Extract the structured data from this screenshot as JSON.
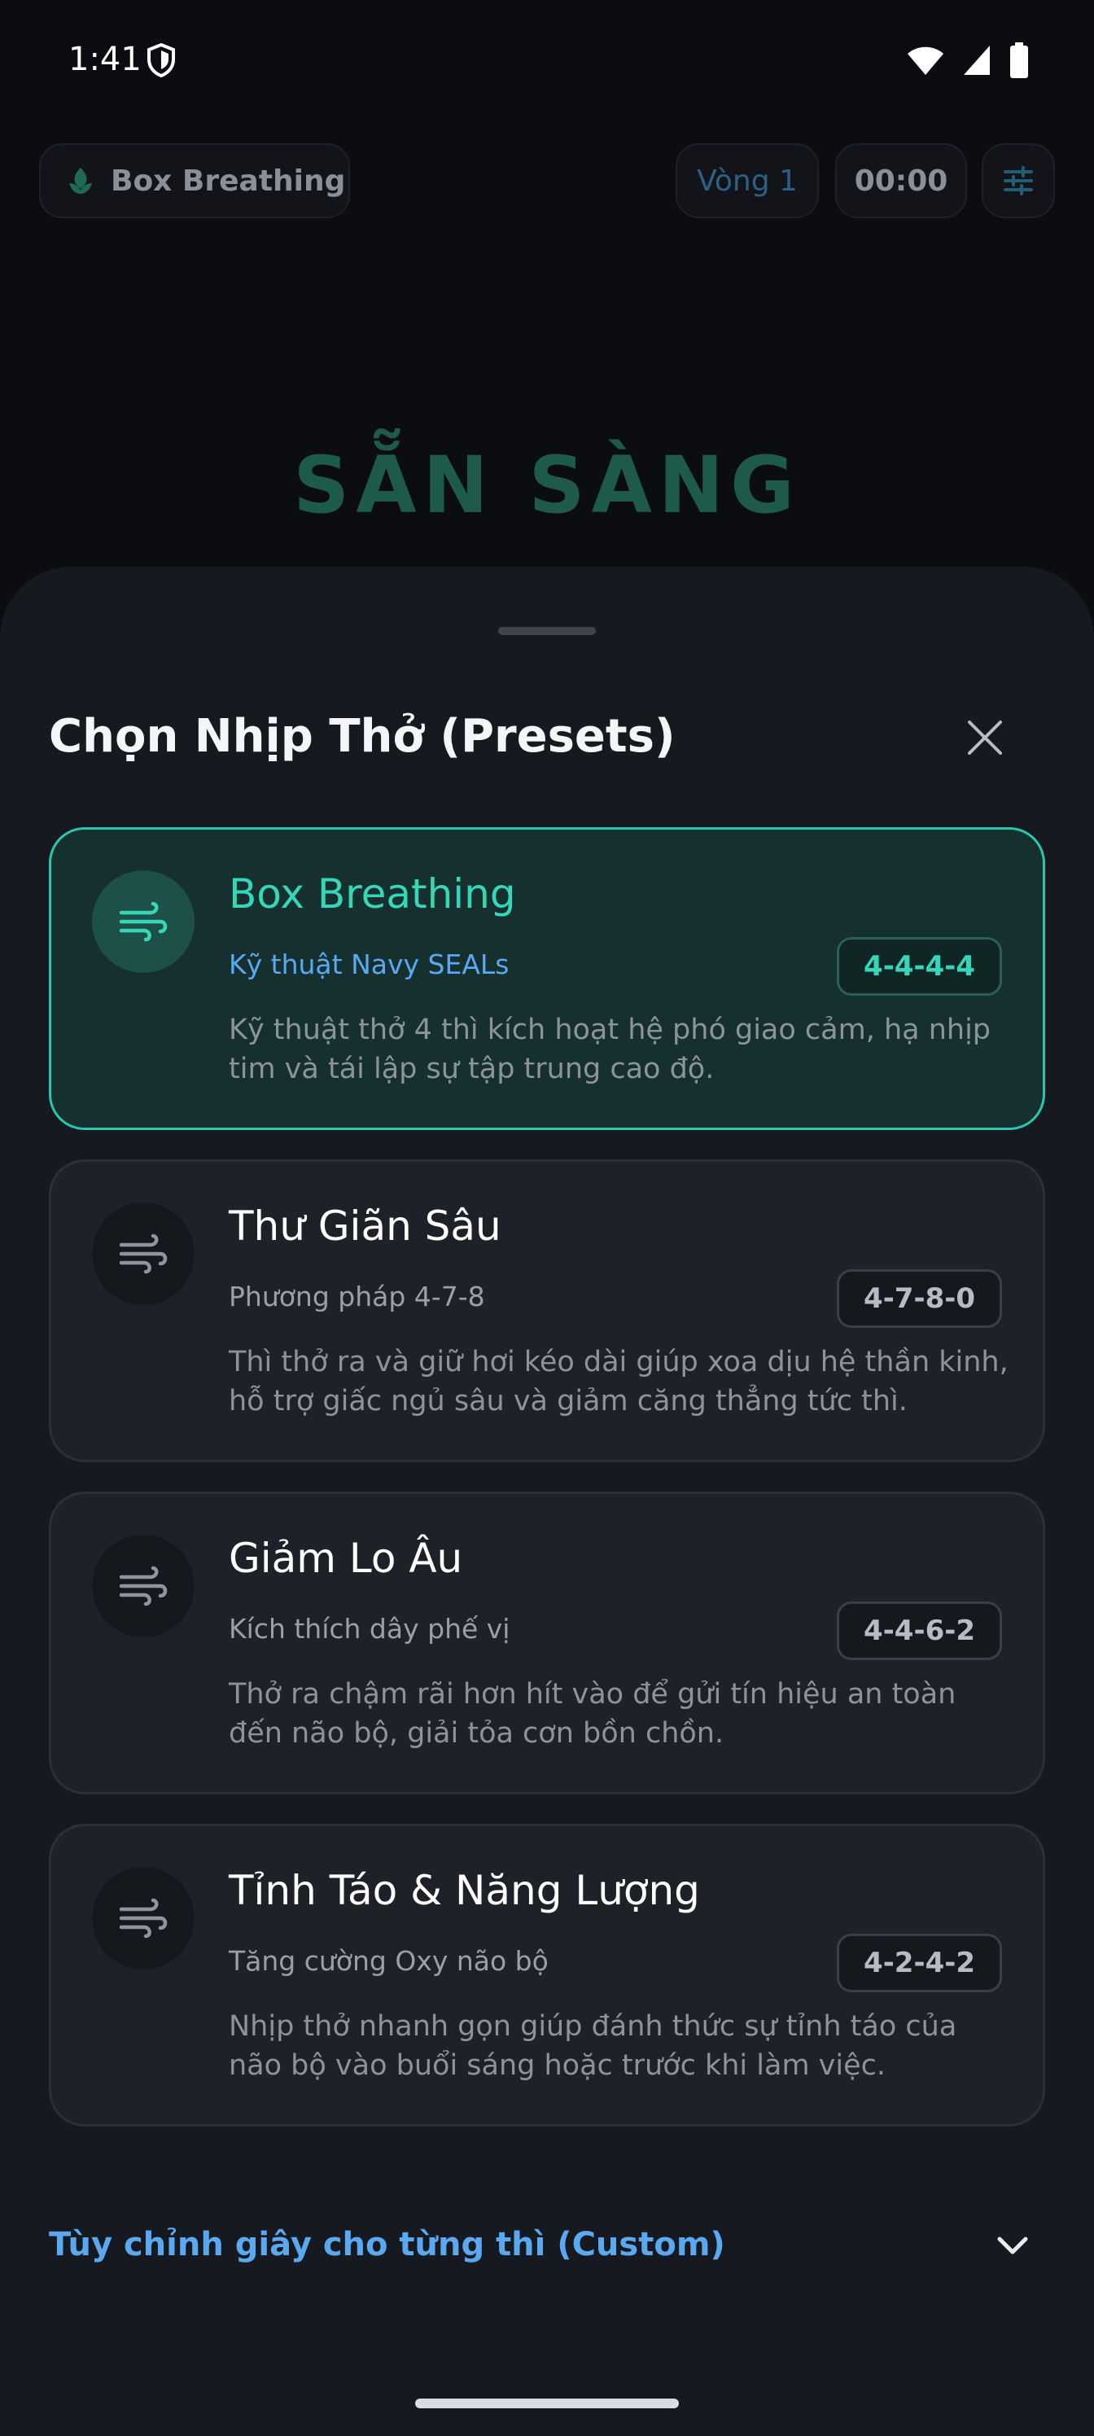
{
  "status_bar": {
    "time": "1:41"
  },
  "app": {
    "mode_chip": "Box Breathing",
    "round_chip": "Vòng 1",
    "timer_chip": "00:00",
    "ready_title": "SẴN SÀNG"
  },
  "sheet": {
    "title": "Chọn Nhịp Thở (Presets)",
    "presets": [
      {
        "name": "Box Breathing",
        "subtitle": "Kỹ thuật Navy SEALs",
        "pattern": "4-4-4-4",
        "description": "Kỹ thuật thở 4 thì kích hoạt hệ phó giao cảm, hạ nhịp tim và tái lập sự tập trung cao độ."
      },
      {
        "name": "Thư Giãn Sâu",
        "subtitle": "Phương pháp 4-7-8",
        "pattern": "4-7-8-0",
        "description": "Thì thở ra và giữ hơi kéo dài giúp xoa dịu hệ thần kinh, hỗ trợ giấc ngủ sâu và giảm căng thẳng tức thì."
      },
      {
        "name": "Giảm Lo Âu",
        "subtitle": "Kích thích dây phế vị",
        "pattern": "4-4-6-2",
        "description": "Thở ra chậm rãi hơn hít vào để gửi tín hiệu an toàn đến não bộ, giải tỏa cơn bồn chồn."
      },
      {
        "name": "Tỉnh Táo & Năng Lượng",
        "subtitle": "Tăng cường Oxy não bộ",
        "pattern": "4-2-4-2",
        "description": "Nhịp thở nhanh gọn giúp đánh thức sự tỉnh táo của não bộ vào buổi sáng hoặc trước khi làm việc."
      }
    ],
    "custom_label": "Tùy chỉnh giây cho từng thì (Custom)"
  },
  "colors": {
    "accent": "#36d7b9",
    "link": "#5aa9f0",
    "sheet_bg": "#16191f"
  }
}
